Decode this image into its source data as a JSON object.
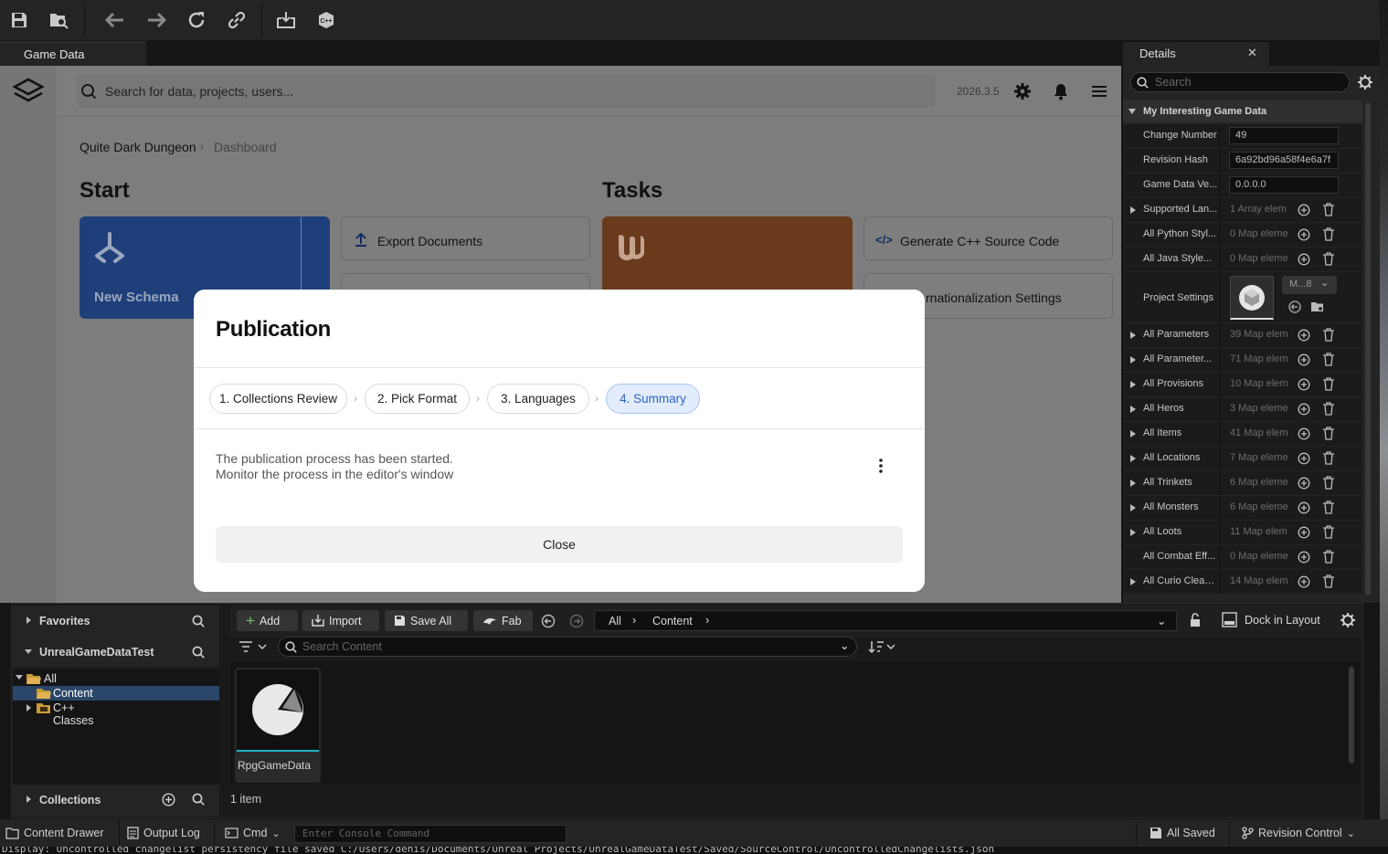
{
  "window": {
    "tab": "Game Data"
  },
  "toolbar": {
    "icons": [
      "save-icon",
      "browse-icon",
      "back-icon",
      "forward-icon",
      "refresh-icon",
      "link-icon",
      "import-icon",
      "cpp-icon"
    ]
  },
  "web": {
    "search_placeholder": "Search for data, projects, users...",
    "version": "2026.3.5",
    "breadcrumb": {
      "project": "Quite Dark Dungeon",
      "page": "Dashboard"
    },
    "start_title": "Start",
    "tasks_title": "Tasks",
    "new_schema": "New Schema",
    "export_documents": "Export Documents",
    "generate_cpp": "Generate C++ Source Code",
    "internationalization": "rnationalization Settings"
  },
  "modal": {
    "title": "Publication",
    "steps": [
      "1. Collections Review",
      "2. Pick Format",
      "3. Languages",
      "4. Summary"
    ],
    "message_line1": "The publication process has been started.",
    "message_line2": "Monitor the process in the editor's window",
    "close_label": "Close"
  },
  "details": {
    "tab_label": "Details",
    "search_placeholder": "Search",
    "section": "My Interesting Game Data",
    "change_number_label": "Change Number",
    "change_number": "49",
    "revision_hash_label": "Revision Hash",
    "revision_hash": "6a92bd96a58f4e6a7f",
    "game_data_version_label": "Game Data Ve...",
    "game_data_version": "0.0.0.0",
    "project_settings_label": "Project Settings",
    "project_settings_value": "M...8",
    "rows": [
      {
        "label": "Supported Lan...",
        "value": "1 Array elem",
        "expandable": true
      },
      {
        "label": "All Python Styl...",
        "value": "0 Map eleme",
        "expandable": false
      },
      {
        "label": "All Java Style...",
        "value": "0 Map eleme",
        "expandable": false
      }
    ],
    "rows2": [
      {
        "label": "All Parameters",
        "value": "39 Map elem",
        "expandable": true
      },
      {
        "label": "All Parameter...",
        "value": "71 Map elem",
        "expandable": true
      },
      {
        "label": "All Provisions",
        "value": "10 Map elem",
        "expandable": true
      },
      {
        "label": "All Heros",
        "value": "3 Map eleme",
        "expandable": true
      },
      {
        "label": "All Items",
        "value": "41 Map elem",
        "expandable": true
      },
      {
        "label": "All Locations",
        "value": "7 Map eleme",
        "expandable": true
      },
      {
        "label": "All Trinkets",
        "value": "6 Map eleme",
        "expandable": true
      },
      {
        "label": "All Monsters",
        "value": "6 Map eleme",
        "expandable": true
      },
      {
        "label": "All Loots",
        "value": "11 Map elem",
        "expandable": true
      },
      {
        "label": "All Combat Eff...",
        "value": "0 Map eleme",
        "expandable": false
      },
      {
        "label": "All Curio Clean...",
        "value": "14 Map elem",
        "expandable": true
      }
    ]
  },
  "content_browser": {
    "favorites": "Favorites",
    "project": "UnrealGameDataTest",
    "tree": {
      "all": "All",
      "content": "Content",
      "cpp": "C++ Classes"
    },
    "collections": "Collections",
    "add": "Add",
    "import": "Import",
    "save_all": "Save All",
    "fab": "Fab",
    "path_all": "All",
    "path_content": "Content",
    "dock_in_layout": "Dock in Layout",
    "search_placeholder": "Search Content",
    "asset_name": "RpgGameData",
    "item_count": "1 item"
  },
  "statusbar": {
    "content_drawer": "Content Drawer",
    "output_log": "Output Log",
    "cmd": "Cmd",
    "console_placeholder": "Enter Console Command",
    "all_saved": "All Saved",
    "revision_control": "Revision Control",
    "log_line": "Display: Uncontrolled changelist persistency file saved C:/Users/denis/Documents/Unreal Projects/UnrealGameDataTest/Saved/SourceControl/UncontrolledChangelists.json"
  },
  "colors": {
    "accent_blue": "#2c64c8",
    "orange": "#c2611f",
    "blue_card": "#1f4fb8"
  }
}
